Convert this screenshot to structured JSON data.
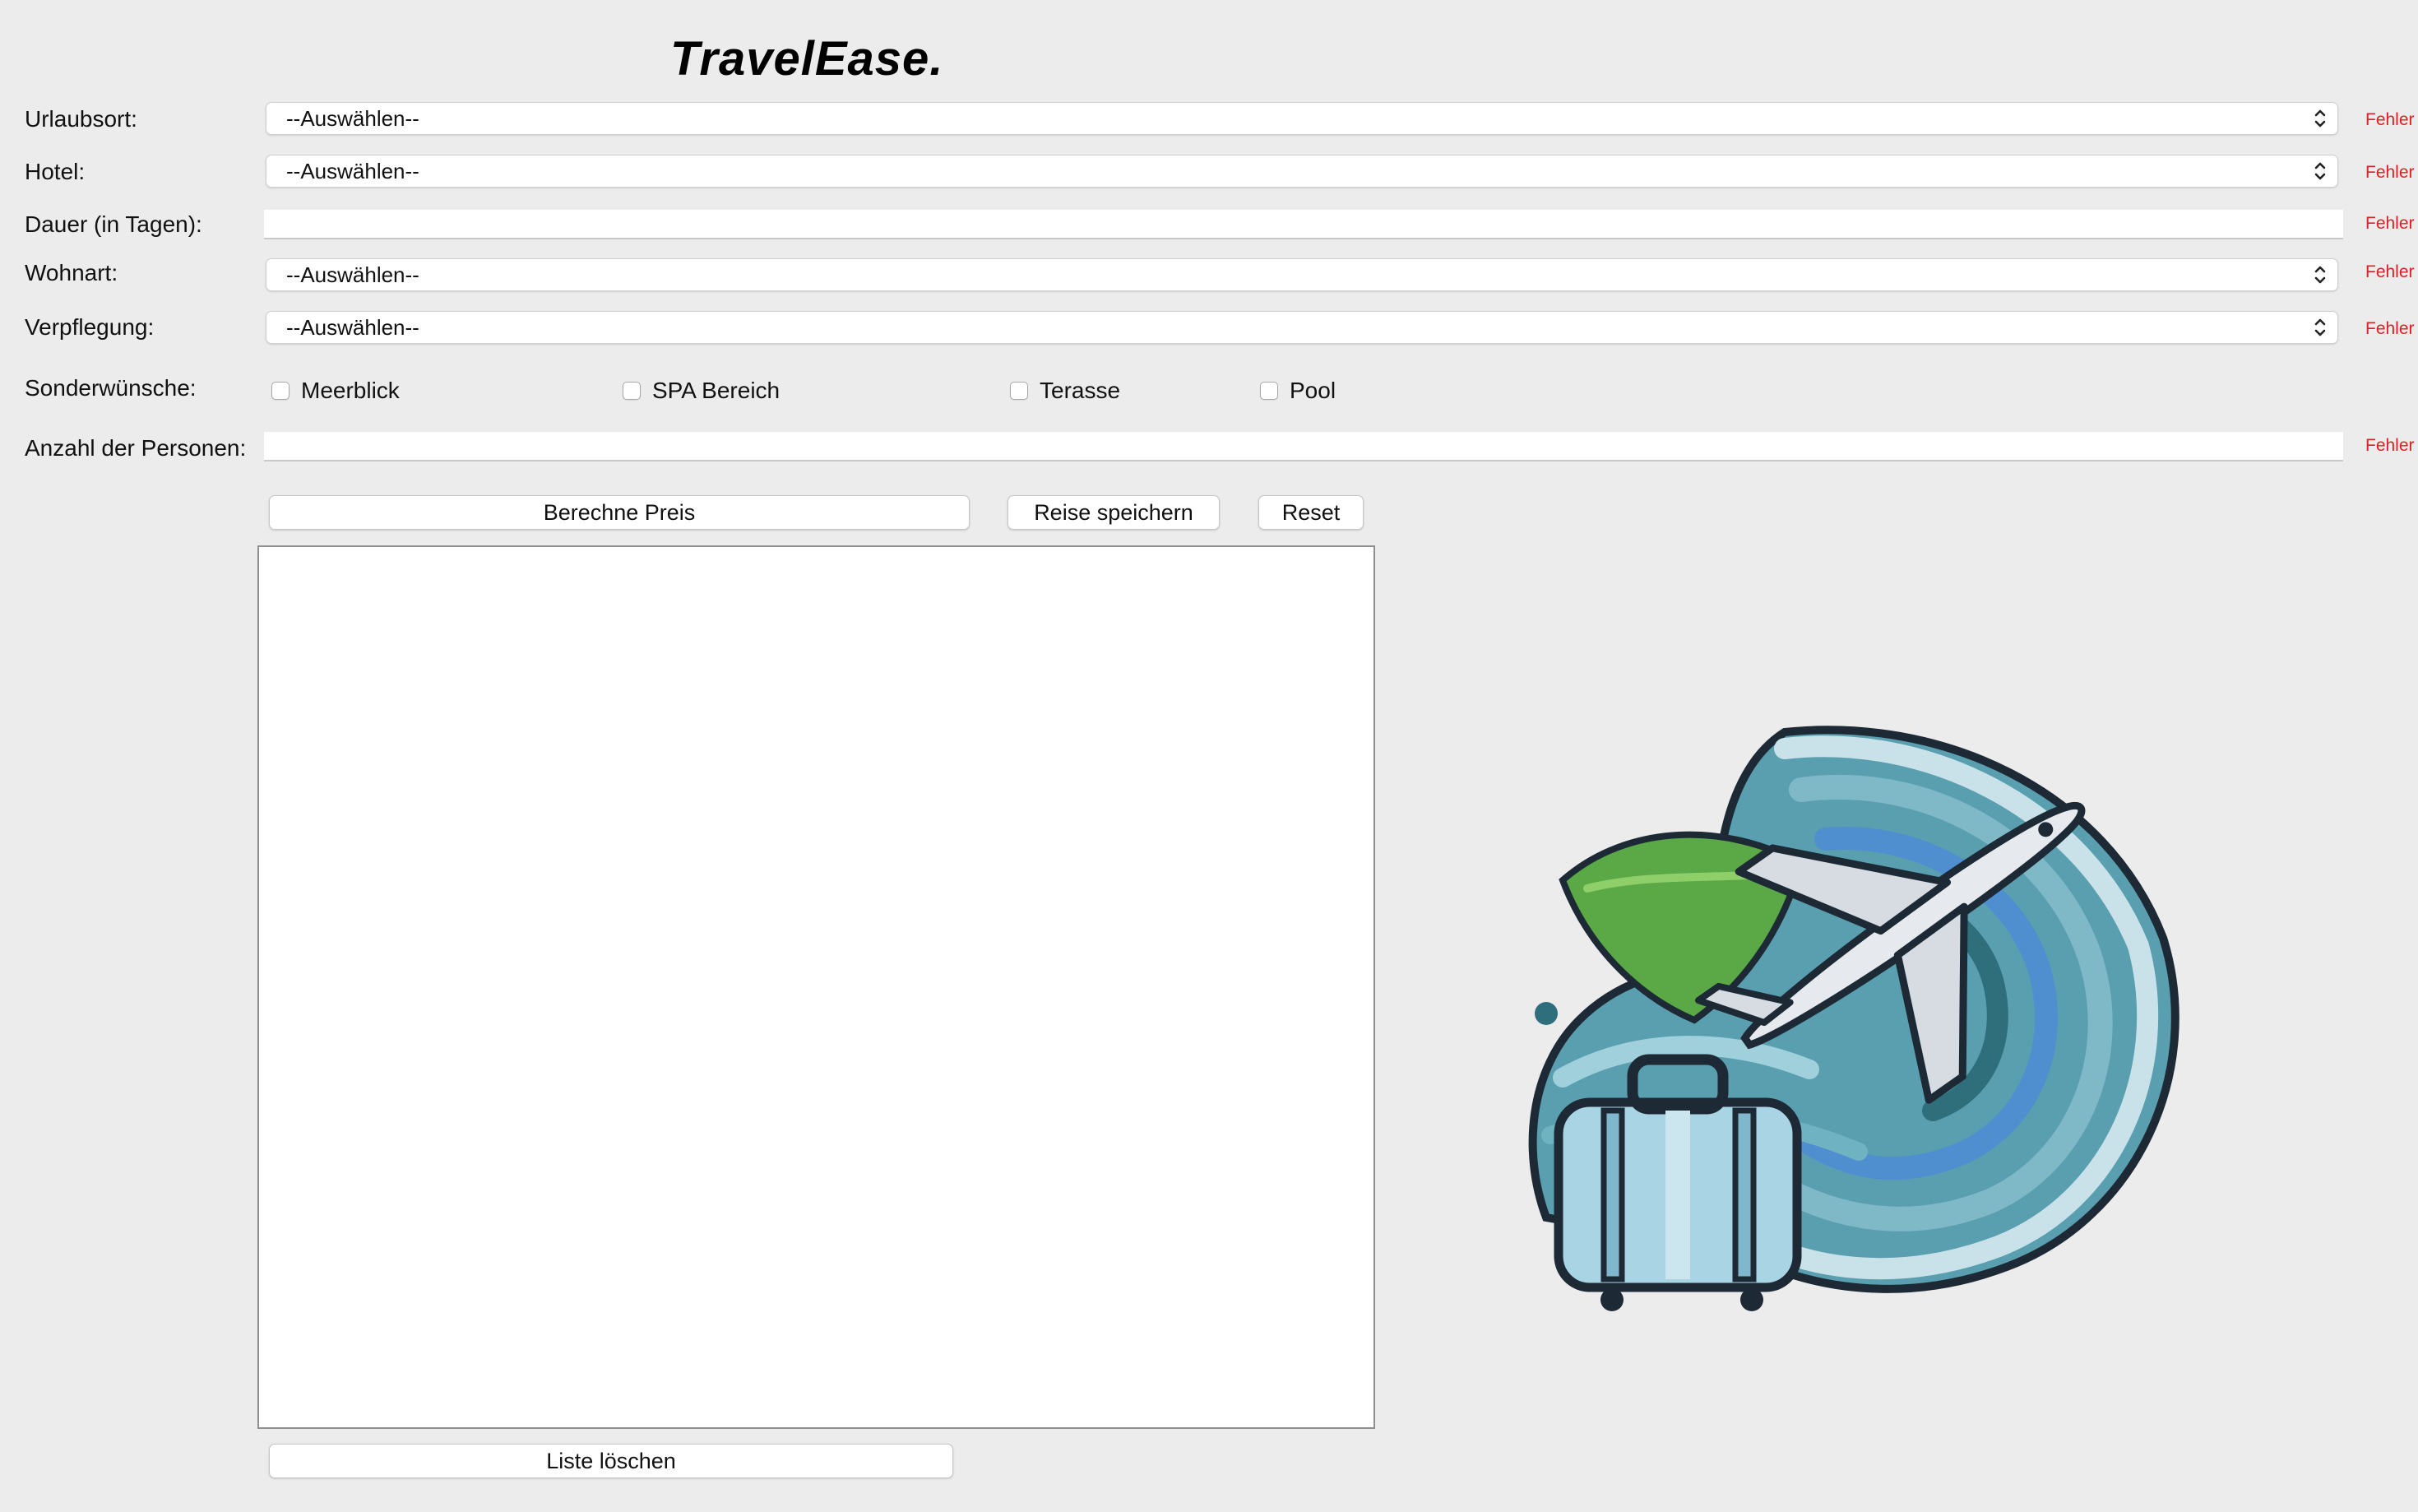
{
  "app": {
    "title": "TravelEase."
  },
  "form": {
    "urlaubsort": {
      "label": "Urlaubsort:",
      "value": "--Auswählen--",
      "error": "Fehler"
    },
    "hotel": {
      "label": "Hotel:",
      "value": "--Auswählen--",
      "error": "Fehler"
    },
    "dauer": {
      "label": "Dauer (in Tagen):",
      "value": "",
      "error": "Fehler"
    },
    "wohnart": {
      "label": "Wohnart:",
      "value": "--Auswählen--",
      "error": "Fehler"
    },
    "verpflegung": {
      "label": "Verpflegung:",
      "value": "--Auswählen--",
      "error": "Fehler"
    },
    "sonderwuensche": {
      "label": "Sonderwünsche:",
      "options": [
        {
          "label": "Meerblick",
          "checked": false
        },
        {
          "label": "SPA Bereich",
          "checked": false
        },
        {
          "label": "Terasse",
          "checked": false
        },
        {
          "label": "Pool",
          "checked": false
        }
      ]
    },
    "personen": {
      "label": "Anzahl der Personen:",
      "value": "",
      "error": "Fehler"
    }
  },
  "buttons": {
    "berechne": "Berechne Preis",
    "speichern": "Reise speichern",
    "reset": "Reset",
    "liste_loeschen": "Liste löschen"
  },
  "list": {
    "items": []
  },
  "colors": {
    "background": "#ececec",
    "error": "#e02020",
    "leaf_green": "#5aa846",
    "wave_teal": "#5a9fb0",
    "wave_blue": "#4f8fcf",
    "outline": "#1d2a35"
  },
  "icons": {
    "select_arrow": "chevron-up-down-icon",
    "logo": "airplane-suitcase-logo"
  }
}
